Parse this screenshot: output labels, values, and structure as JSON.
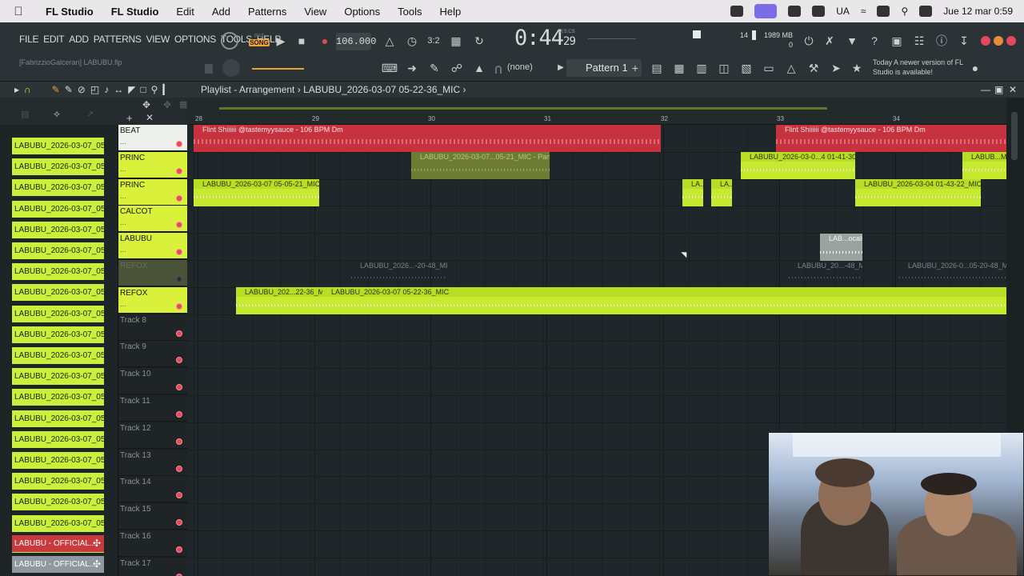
{
  "menubar": {
    "app_name": "FL Studio",
    "items": [
      "FL Studio",
      "Edit",
      "Add",
      "Patterns",
      "View",
      "Options",
      "Tools",
      "Help"
    ],
    "input_lang": "UA",
    "datetime": "Jue 12 mar 0:59"
  },
  "toolbar": {
    "menu": [
      "FILE",
      "EDIT",
      "ADD",
      "PATTERNS",
      "VIEW",
      "OPTIONS",
      "TOOLS",
      "HELP"
    ],
    "project_file": "[FabrizzioGalceran] LABUBU.flp",
    "mode_pat": "PAT",
    "mode_song": "SONG",
    "tempo": "106.000",
    "time_main": "0:44",
    "time_sub": "29",
    "time_format": "M:S:CS",
    "cpu": "14",
    "memory": "1989 MB",
    "memory_sub": "0",
    "channel": "(none)",
    "pattern": "Pattern 1",
    "news_date": "Today",
    "news_text": "A newer version of FL Studio is available!"
  },
  "playlist": {
    "title": "Playlist - Arrangement",
    "clip_name": "LABUBU_2026-03-07 05-22-36_MIC",
    "bars": [
      "28",
      "29",
      "30",
      "31",
      "32",
      "33",
      "34"
    ]
  },
  "picker_items": [
    "LABUBU_2026-03-07_05...",
    "LABUBU_2026-03-07_05...",
    "LABUBU_2026-03-07_05...",
    "LABUBU_2026-03-07_05...",
    "LABUBU_2026-03-07_05...",
    "LABUBU_2026-03-07_05...",
    "LABUBU_2026-03-07_05...",
    "LABUBU_2026-03-07_05...",
    "LABUBU_2026-03-07_05...",
    "LABUBU_2026-03-07_05...",
    "LABUBU_2026-03-07_05...",
    "LABUBU_2026-03-07_05...",
    "LABUBU_2026-03-07_05...",
    "LABUBU_2026-03-07_05...",
    "LABUBU_2026-03-07_05...",
    "LABUBU_2026-03-07_05...",
    "LABUBU_2026-03-07_05...",
    "LABUBU_2026-03-07_05...",
    "LABUBU_2026-03-07_05...",
    "LABUBU_2026-03-07_05..."
  ],
  "picker_audio": [
    "LABUBU - OFFICIAL...",
    "LABUBU - OFFICIAL..."
  ],
  "tracks": [
    "BEAT",
    "PRINC",
    "PRINC",
    "CALCOT",
    "LABUBU",
    "REFOX",
    "REFOX",
    "Track 8",
    "Track 9",
    "Track 10",
    "Track 11",
    "Track 12",
    "Track 13",
    "Track 14",
    "Track 15",
    "Track 16",
    "Track 17"
  ],
  "clips": {
    "beat_1": "Flint Shiiiiii @tastemyysauce - 106 BPM Dm",
    "beat_2": "Flint Shiiiiii @tastemyysauce - 106 BPM Dm",
    "p1_part2": "LABUBU_2026-03-07...05-21_MIC - Part_2",
    "p1_a": "LABUBU_2026-03-0...4 01-41-30_MIC",
    "p1_b": "LABUB...MIC",
    "p2_a": "LABUBU_2026-03-07 05-05-21_MIC",
    "p2_b": "LA...",
    "p2_c": "LA...",
    "p2_d": "LABUBU_2026-03-04 01-43-22_MIC",
    "lab_a": "LAB...ocals",
    "refox_a": "LABUBU_2026...-20-48_MIC",
    "refox_b": "LABUBU_20...-48_MIC",
    "refox_c": "LABUBU_2026-0...05-20-48_MIC",
    "main_a": "LABUBU_202...22-36_MIC",
    "main_b": "LABUBU_2026-03-07 05-22-36_MIC"
  }
}
